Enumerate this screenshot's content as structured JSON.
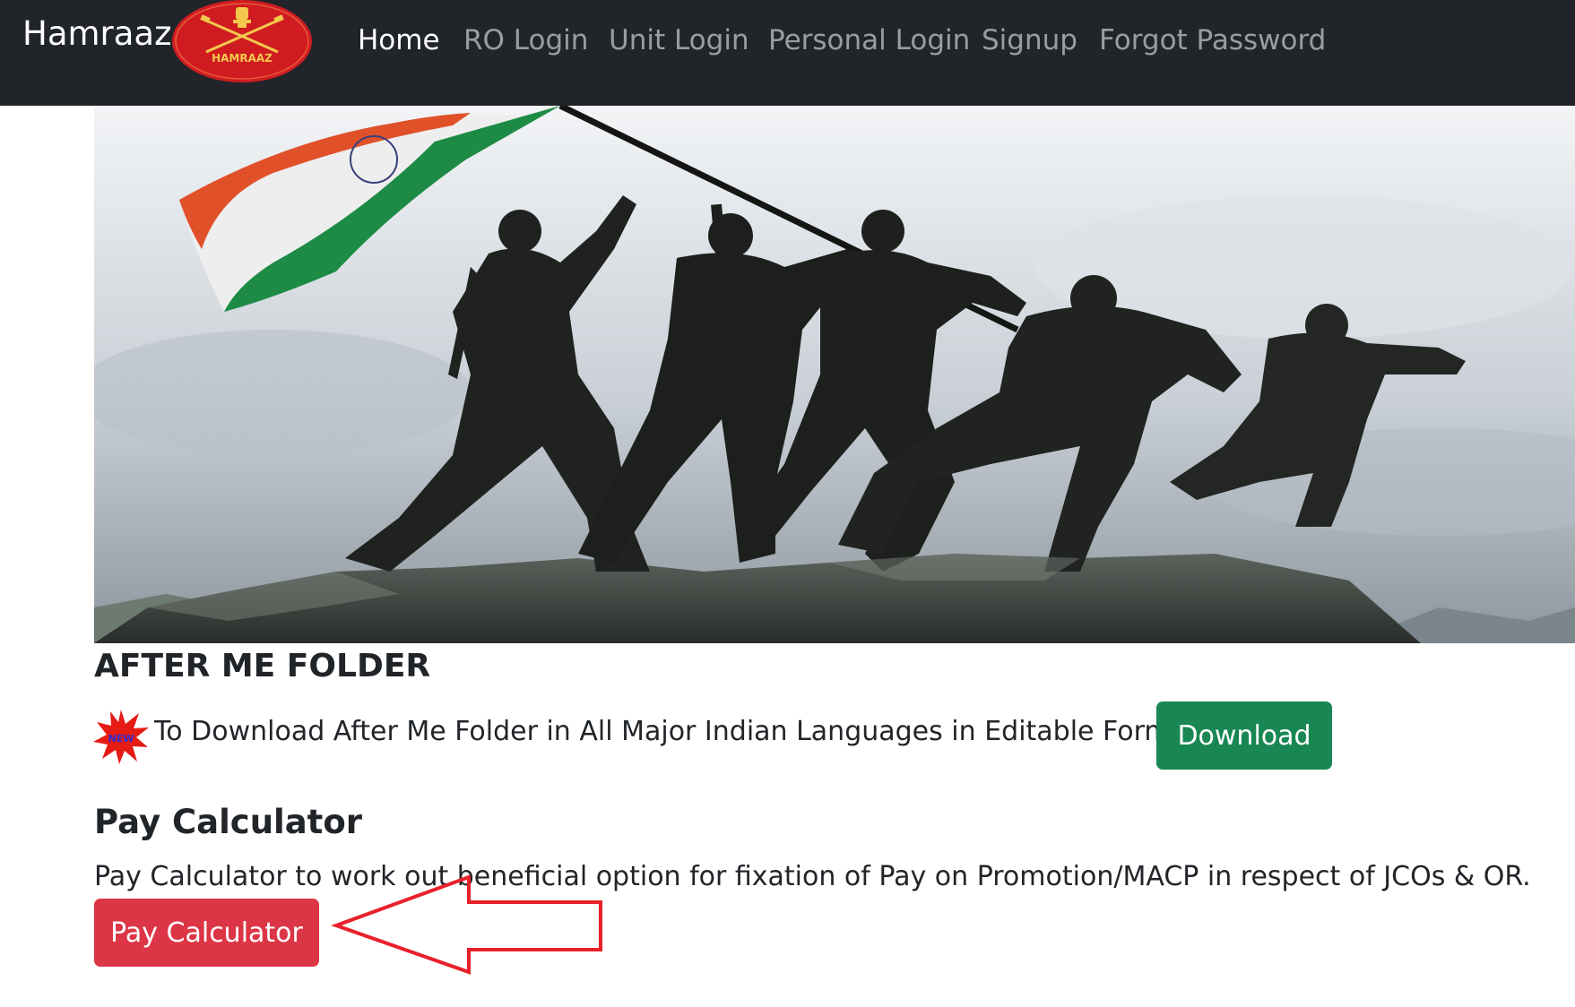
{
  "navbar": {
    "brand": "Hamraaz",
    "logo_text": "HAMRAAZ",
    "items": [
      {
        "label": "Home",
        "active": true
      },
      {
        "label": "RO Login"
      },
      {
        "label": "Unit Login"
      },
      {
        "label": "Personal Login"
      },
      {
        "label": "Signup"
      },
      {
        "label": "Forgot Password"
      }
    ]
  },
  "after_me": {
    "title": "AFTER ME FOLDER",
    "badge": "NEW",
    "text": "To Download After Me Folder in All Major Indian Languages in Editable Format",
    "button": "Download"
  },
  "pay_calculator": {
    "title": "Pay Calculator",
    "description": "Pay Calculator to work out beneficial option for fixation of Pay on Promotion/MACP in respect of JCOs & OR.",
    "button": "Pay Calculator"
  },
  "colors": {
    "navbar_bg": "#212529",
    "download_green": "#198754",
    "pay_red": "#dc3545",
    "arrow_red": "#e8202a",
    "logo_red": "#d01c20"
  },
  "icons": {
    "badge": "new-starburst-icon",
    "logo": "army-emblem-logo"
  }
}
